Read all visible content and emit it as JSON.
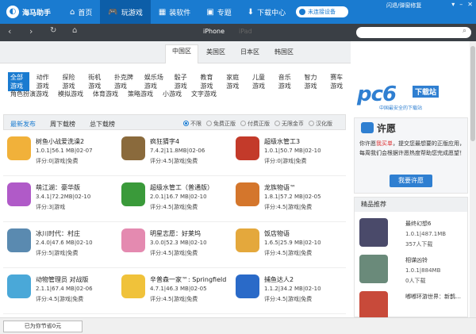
{
  "app": {
    "title": "海马助手",
    "user": "闪退/弹窗修复"
  },
  "nav": [
    {
      "label": "首页",
      "icon": "home-icon",
      "glyph": "⌂"
    },
    {
      "label": "玩游戏",
      "icon": "gamepad-icon",
      "glyph": "🎮"
    },
    {
      "label": "装软件",
      "icon": "apps-icon",
      "glyph": "▦"
    },
    {
      "label": "专题",
      "icon": "topic-icon",
      "glyph": "▣"
    },
    {
      "label": "下载中心",
      "icon": "download-icon",
      "glyph": "⬇"
    }
  ],
  "device": {
    "status": "未连接设备"
  },
  "toolbar": {
    "tab_iphone": "iPhone",
    "tab_ipad": "iPad"
  },
  "regions": [
    "中国区",
    "美国区",
    "日本区",
    "韩国区"
  ],
  "categories_row1": [
    "全部游戏",
    "动作游戏",
    "探险游戏",
    "街机游戏",
    "扑克牌游戏",
    "娱乐场游戏",
    "骰子游戏",
    "教育游戏",
    "家庭游戏",
    "儿童游戏",
    "音乐游戏",
    "智力游戏",
    "赛车游戏"
  ],
  "categories_row2": [
    "角色扮演游戏",
    "模拟游戏",
    "体育游戏",
    "策略游戏",
    "小游戏",
    "文字游戏"
  ],
  "filters": {
    "tabs": [
      "最新发布",
      "周下载榜",
      "总下载榜"
    ],
    "options": [
      "不限",
      "免费正版",
      "付费正版",
      "无限金币",
      "汉化版"
    ]
  },
  "games": [
    {
      "name": "树鱼小战爱洗澡2",
      "meta": "1.0.1|56.1 MB|02-07",
      "rate": "评分:0|游戏|免费",
      "color": "#f1b13a"
    },
    {
      "name": "疯狂猜字4",
      "meta": "7.4.2|11.8MB|02-06",
      "rate": "评分:4.5|游戏|免费",
      "color": "#8a6a3c"
    },
    {
      "name": "超级水管工3",
      "meta": "1.0.1|50.7 MB|02-10",
      "rate": "评分:0|游戏|免费",
      "color": "#c33a2a"
    },
    {
      "name": "萌江湖：豪华版",
      "meta": "3.4.1|72.2MB|02-10",
      "rate": "评分:3|游戏",
      "color": "#b05ac8"
    },
    {
      "name": "超级水管工（普通版）",
      "meta": "2.0.1|16.7 MB|02-10",
      "rate": "评分:4.5|游戏|免费",
      "color": "#3a9a3a"
    },
    {
      "name": "龙族物语™",
      "meta": "1.8.1|57.2 MB|02-05",
      "rate": "评分:4.5|游戏|免费",
      "color": "#d4762c"
    },
    {
      "name": "冰川时代：村庄",
      "meta": "2.4.0|47.6 MB|02-10",
      "rate": "评分:5|游戏|免费",
      "color": "#5a8ab0"
    },
    {
      "name": "明星志愿：好莱坞",
      "meta": "3.0.0|52.3 MB|02-10",
      "rate": "评分:4.5|游戏|免费",
      "color": "#e48ab0"
    },
    {
      "name": "饭店物语",
      "meta": "1.6.5|25.9 MB|02-10",
      "rate": "评分:4.5|游戏|免费",
      "color": "#e4a83c"
    },
    {
      "name": "动物管理员 对战版",
      "meta": "2.1.1|67.4 MB|02-06",
      "rate": "评分:4.5|游戏|免费",
      "color": "#4aa8d8"
    },
    {
      "name": "辛普森一家™: Springfield",
      "meta": "4.7.1|46.3 MB|02-05",
      "rate": "评分:4.5|游戏|免费",
      "color": "#f0c23a"
    },
    {
      "name": "捕鱼达人2",
      "meta": "1.1.2|34.2 MB|02-10",
      "rate": "评分:4.5|游戏|免费",
      "color": "#2a6ac8"
    }
  ],
  "sidebar": {
    "watermark": "pc6",
    "watermark_badge": "下载站",
    "watermark_sub": "中国最安全的下载站",
    "wish_title": "许愿",
    "wish_text_a": "你许愿",
    "wish_text_red": "我买单",
    "wish_text_b": "，提交您最想要的正版应用，每周我们会根据许愿热度帮助您完成愿望！",
    "wish_button": "我要许愿",
    "picks_title": "精品推荐",
    "picks": [
      {
        "name": "最终幻想6",
        "meta": "1.0.1|487.1MB",
        "dl": "357人下载",
        "color": "#4a4a6a"
      },
      {
        "name": "相谋凶铃",
        "meta": "1.0.1|884MB",
        "dl": "0人下载",
        "color": "#6a8a7a"
      },
      {
        "name": "嘟嘟环游世界：新鹊…",
        "meta": "",
        "dl": "",
        "color": "#c84a3a"
      }
    ]
  },
  "status": {
    "saved": "已为你节省0元"
  }
}
